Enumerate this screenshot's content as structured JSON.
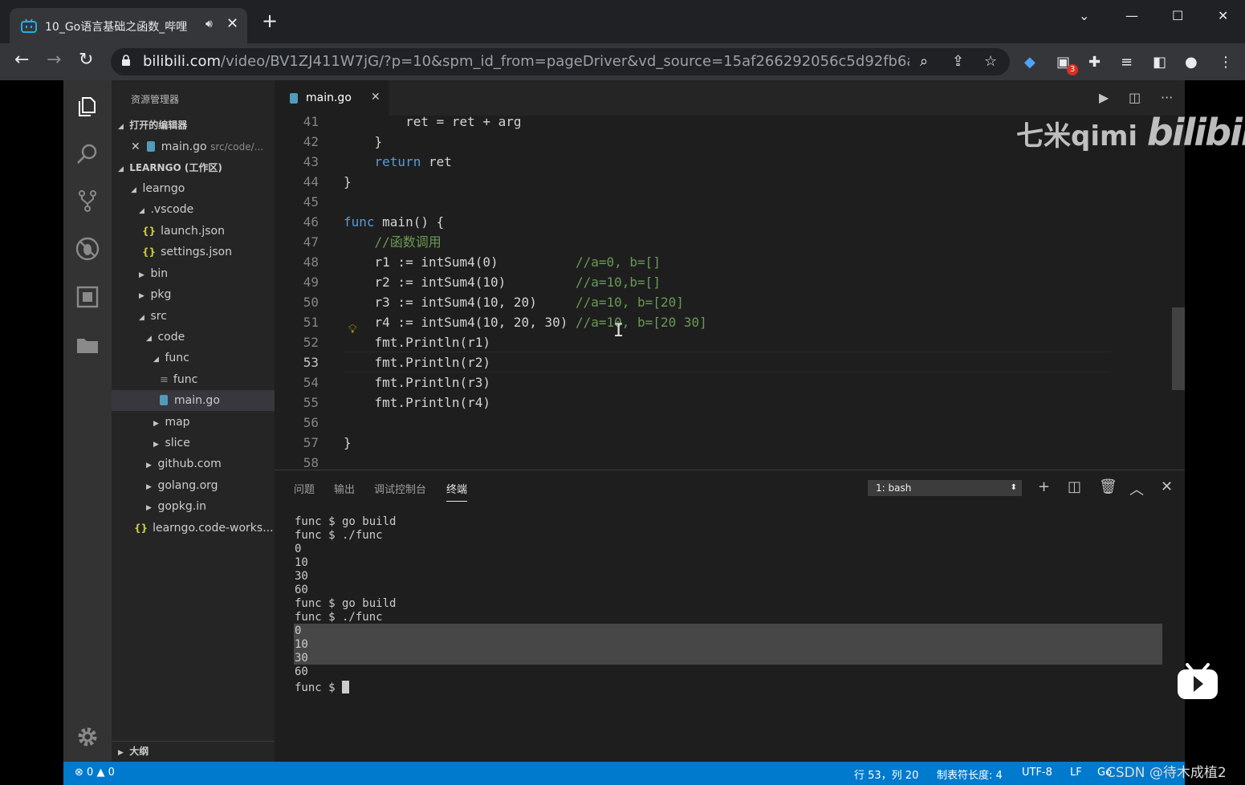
{
  "browser": {
    "tab_title": "10_Go语言基础之函数_哔哩",
    "url_host": "bilibili.com",
    "url_path": "/video/BV1ZJ411W7jG/?p=10&spm_id_from=pageDriver&vd_source=15af266292056c5d92fb6aa45a...",
    "extension_badge": "3"
  },
  "vscode": {
    "sidebar": {
      "title": "资源管理器",
      "open_editors_header": "打开的编辑器",
      "open_editor_file": "main.go",
      "open_editor_path": "src/code/...",
      "workspace_header": "LEARNGO (工作区)",
      "tree": [
        {
          "label": "learngo"
        },
        {
          "label": ".vscode"
        },
        {
          "label": "launch.json"
        },
        {
          "label": "settings.json"
        },
        {
          "label": "bin"
        },
        {
          "label": "pkg"
        },
        {
          "label": "src"
        },
        {
          "label": "code"
        },
        {
          "label": "func"
        },
        {
          "label": "func"
        },
        {
          "label": "main.go"
        },
        {
          "label": "map"
        },
        {
          "label": "slice"
        },
        {
          "label": "github.com"
        },
        {
          "label": "golang.org"
        },
        {
          "label": "gopkg.in"
        },
        {
          "label": "learngo.code-works..."
        }
      ],
      "outline_header": "大纲"
    },
    "editor": {
      "tab_label": "main.go",
      "lines": [
        {
          "n": "41",
          "t": "        ret = ret + arg"
        },
        {
          "n": "42",
          "t": "    }"
        },
        {
          "n": "43",
          "k": "    return",
          "t": " ret"
        },
        {
          "n": "44",
          "t": "}"
        },
        {
          "n": "45",
          "t": ""
        },
        {
          "n": "46",
          "k": "func",
          "t": " main() {"
        },
        {
          "n": "47",
          "t": "    ",
          "c": "//函数调用"
        },
        {
          "n": "48",
          "t": "    r1 := intSum4(0)          ",
          "c": "//a=0, b=[]"
        },
        {
          "n": "49",
          "t": "    r2 := intSum4(10)         ",
          "c": "//a=10,b=[]"
        },
        {
          "n": "50",
          "t": "    r3 := intSum4(10, 20)     ",
          "c": "//a=10, b=[20]"
        },
        {
          "n": "51",
          "t": "    r4 := intSum4(10, 20, 30) ",
          "c": "//a=10, b=[20 30]"
        },
        {
          "n": "52",
          "t": "    fmt.Println(r1)"
        },
        {
          "n": "53",
          "t": "    fmt.Println(r2)"
        },
        {
          "n": "54",
          "t": "    fmt.Println(r3)"
        },
        {
          "n": "55",
          "t": "    fmt.Println(r4)"
        },
        {
          "n": "56",
          "t": ""
        },
        {
          "n": "57",
          "t": "}"
        },
        {
          "n": "58",
          "t": ""
        }
      ],
      "current_line": "53",
      "watermark_text": "七米qimi",
      "watermark_logo": "bilibili"
    },
    "panel": {
      "tabs": [
        "问题",
        "输出",
        "调试控制台",
        "终端"
      ],
      "active_tab": "终端",
      "terminal_select": "1: bash",
      "terminal_lines": [
        "func $ go build",
        "func $ ./func",
        "0",
        "10",
        "30",
        "60",
        "func $ go build",
        "func $ ./func",
        "0",
        "10",
        "30",
        "60"
      ],
      "prompt": "func $ "
    },
    "statusbar": {
      "errors": "0",
      "warnings": "0",
      "position": "行 53，列 20",
      "tab_size": "制表符长度: 4",
      "encoding": "UTF-8",
      "eol": "LF",
      "language": "Go"
    }
  },
  "overlay": {
    "csdn_watermark": "CSDN @待木成植2"
  }
}
